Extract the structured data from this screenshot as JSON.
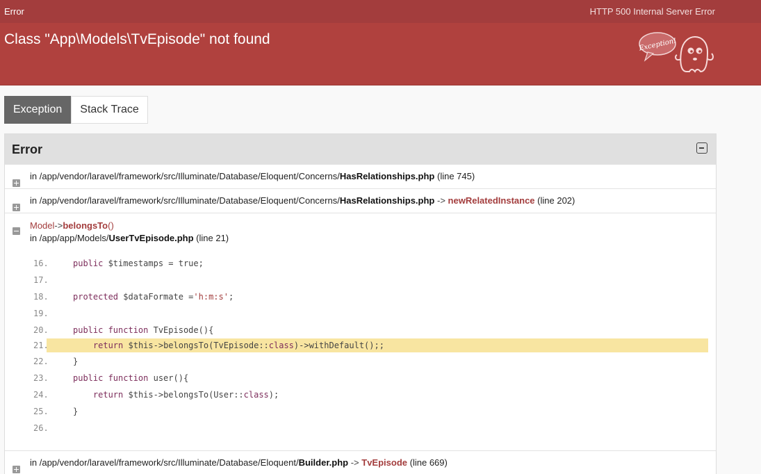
{
  "topbar": {
    "left": "Error",
    "right": "HTTP 500 Internal Server Error"
  },
  "header": {
    "title": "Class \"App\\Models\\TvEpisode\" not found",
    "mascot_text": "Exception!"
  },
  "tabs": [
    {
      "label": "Exception",
      "active": true
    },
    {
      "label": "Stack Trace",
      "active": false
    }
  ],
  "panel": {
    "title": "Error",
    "frames": [
      {
        "prefix": "in /app/vendor/laravel/framework/src/Illuminate/Database/Eloquent/Concerns/",
        "file": "HasRelationships.php",
        "line_text": "(line 745)",
        "method": ""
      },
      {
        "prefix": "in /app/vendor/laravel/framework/src/Illuminate/Database/Eloquent/Concerns/",
        "file": "HasRelationships.php",
        "arrow": "->",
        "method": "newRelatedInstance",
        "line_text": "(line 202)"
      },
      {
        "cls": "Model",
        "arrow": "->",
        "method": "belongsTo",
        "parens": "()",
        "prefix": "in /app/app/Models/",
        "file": "UserTvEpisode.php",
        "line_text": "(line 21)"
      },
      {
        "prefix": "in /app/vendor/laravel/framework/src/Illuminate/Database/Eloquent/",
        "file": "Builder.php",
        "arrow": "->",
        "method": "TvEpisode",
        "line_text": "(line 669)"
      }
    ],
    "code": [
      {
        "n": "16.",
        "t": "public $timestamps = true;"
      },
      {
        "n": "17.",
        "t": ""
      },
      {
        "n": "18.",
        "t": "protected $dataFormate ='h:m:s';"
      },
      {
        "n": "19.",
        "t": ""
      },
      {
        "n": "20.",
        "t": "public function TvEpisode(){"
      },
      {
        "n": "21.",
        "t": "    return $this->belongsTo(TvEpisode::class)->withDefault();;",
        "highlight": true
      },
      {
        "n": "22.",
        "t": "}"
      },
      {
        "n": "23.",
        "t": "public function user(){"
      },
      {
        "n": "24.",
        "t": "    return $this->belongsTo(User::class);"
      },
      {
        "n": "25.",
        "t": "}"
      },
      {
        "n": "26.",
        "t": ""
      }
    ]
  }
}
